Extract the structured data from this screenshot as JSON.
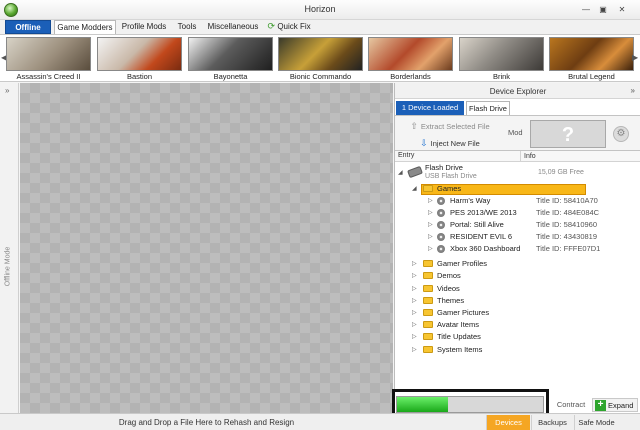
{
  "window": {
    "title": "Horizon"
  },
  "menu": {
    "offline": "Offline",
    "tabs": [
      "Game Modders",
      "Profile Mods",
      "Tools",
      "Miscellaneous",
      "Quick Fix"
    ]
  },
  "games": [
    "Assassin's Creed II",
    "Bastion",
    "Bayonetta",
    "Bionic Commando",
    "Borderlands",
    "Brink",
    "Brutal Legend"
  ],
  "sidebar": {
    "label": "Offline Mode"
  },
  "main": {
    "drop_hint": "Drag and Drop a File Here to Rehash and Resign"
  },
  "explorer": {
    "title": "Device Explorer",
    "tabs": [
      "1 Device Loaded",
      "Flash Drive"
    ],
    "buttons": {
      "extract": "Extract Selected File",
      "inject": "Inject New File"
    },
    "mod_label": "Mod",
    "mod_placeholder": "?",
    "columns": {
      "entry": "Entry",
      "info": "Info"
    },
    "device": {
      "name": "Flash Drive",
      "type": "USB Flash Drive",
      "free": "15,09 GB Free"
    },
    "games_folder": "Games",
    "games": [
      {
        "name": "Harm's Way",
        "title_id": "Title ID: 58410A70"
      },
      {
        "name": "PES 2013/WE 2013",
        "title_id": "Title ID: 484E084C"
      },
      {
        "name": "Portal: Still Alive",
        "title_id": "Title ID: 58410960"
      },
      {
        "name": "RESIDENT EVIL 6",
        "title_id": "Title ID: 43430819"
      },
      {
        "name": "Xbox 360 Dashboard",
        "title_id": "Title ID: FFFE07D1"
      }
    ],
    "folders": [
      "Gamer Profiles",
      "Demos",
      "Videos",
      "Themes",
      "Gamer Pictures",
      "Avatar Items",
      "Title Updates",
      "System Items"
    ],
    "contract": "Contract",
    "expand": "Expand"
  },
  "progress": {
    "value": 0.35
  },
  "bottom_tabs": [
    "Devices",
    "Backups",
    "Safe Mode"
  ],
  "colors": {
    "accent": "#1b5fb8",
    "highlight": "#f8b718",
    "progress": "#1aa81a"
  }
}
